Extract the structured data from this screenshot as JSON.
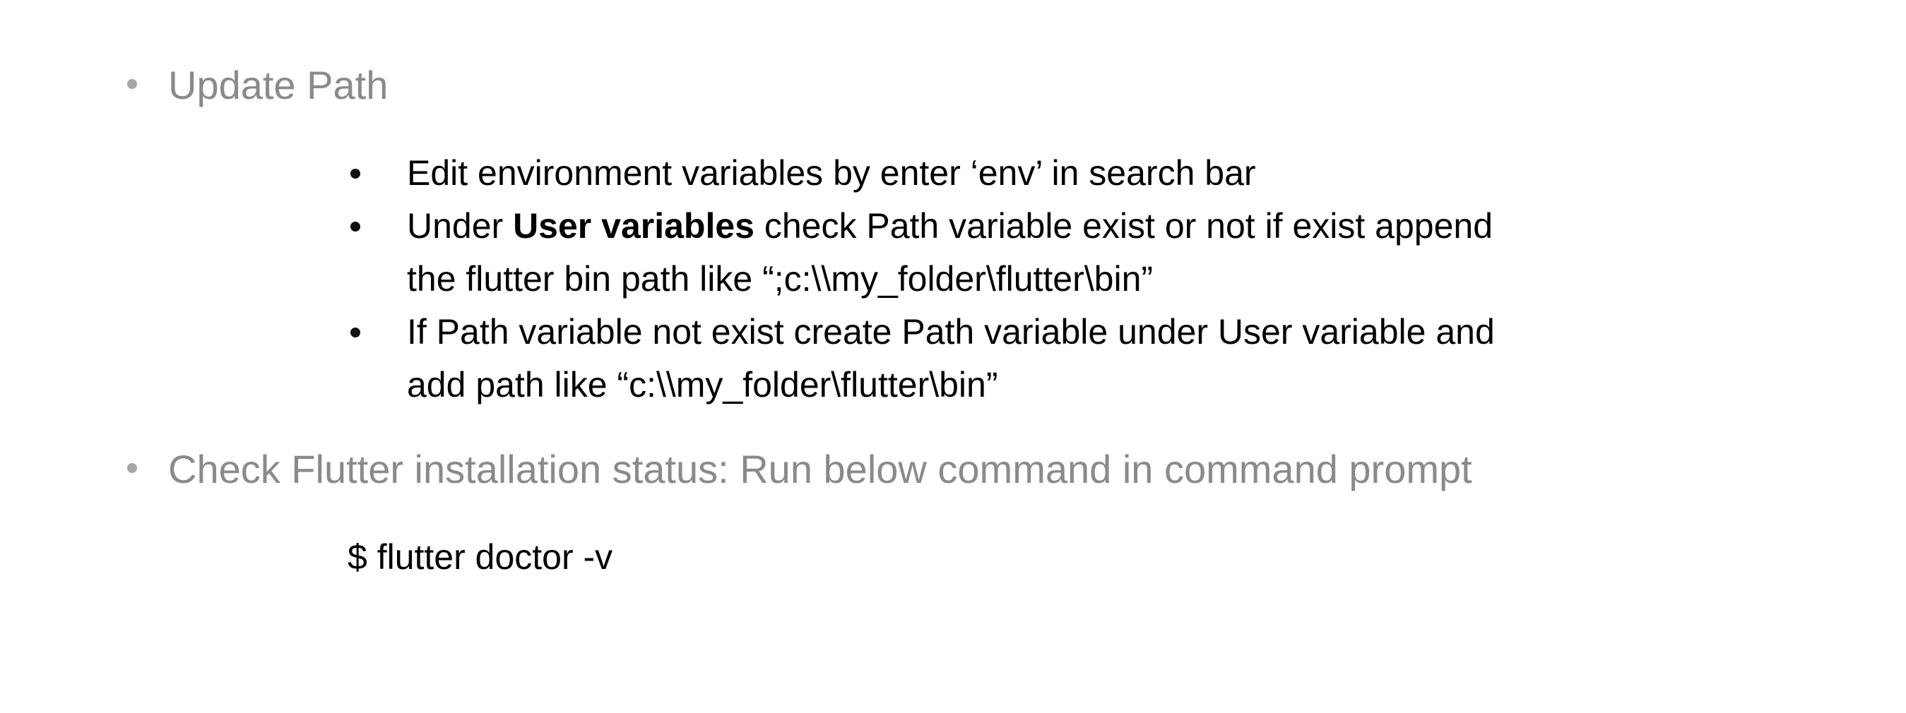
{
  "slide": {
    "items": [
      {
        "text": "Update Path",
        "sub_items": [
          {
            "text": "Edit environment variables by enter ‘env’ in search bar"
          },
          {
            "prefix": "Under ",
            "bold": "User variables",
            "suffix": " check Path variable exist or not if exist append the flutter bin path like “;c:\\\\my_folder\\flutter\\bin”"
          },
          {
            "text": "If Path variable not exist create Path variable under User variable and add path like “c:\\\\my_folder\\flutter\\bin”"
          }
        ]
      },
      {
        "text": "Check Flutter installation status: Run below command in command prompt",
        "command": "$ flutter doctor -v"
      }
    ]
  },
  "colors": {
    "primary_bullet_text": "#8a8a8a",
    "primary_bullet_dot": "#a6a6a6",
    "body_text": "#000000",
    "background": "#ffffff"
  }
}
